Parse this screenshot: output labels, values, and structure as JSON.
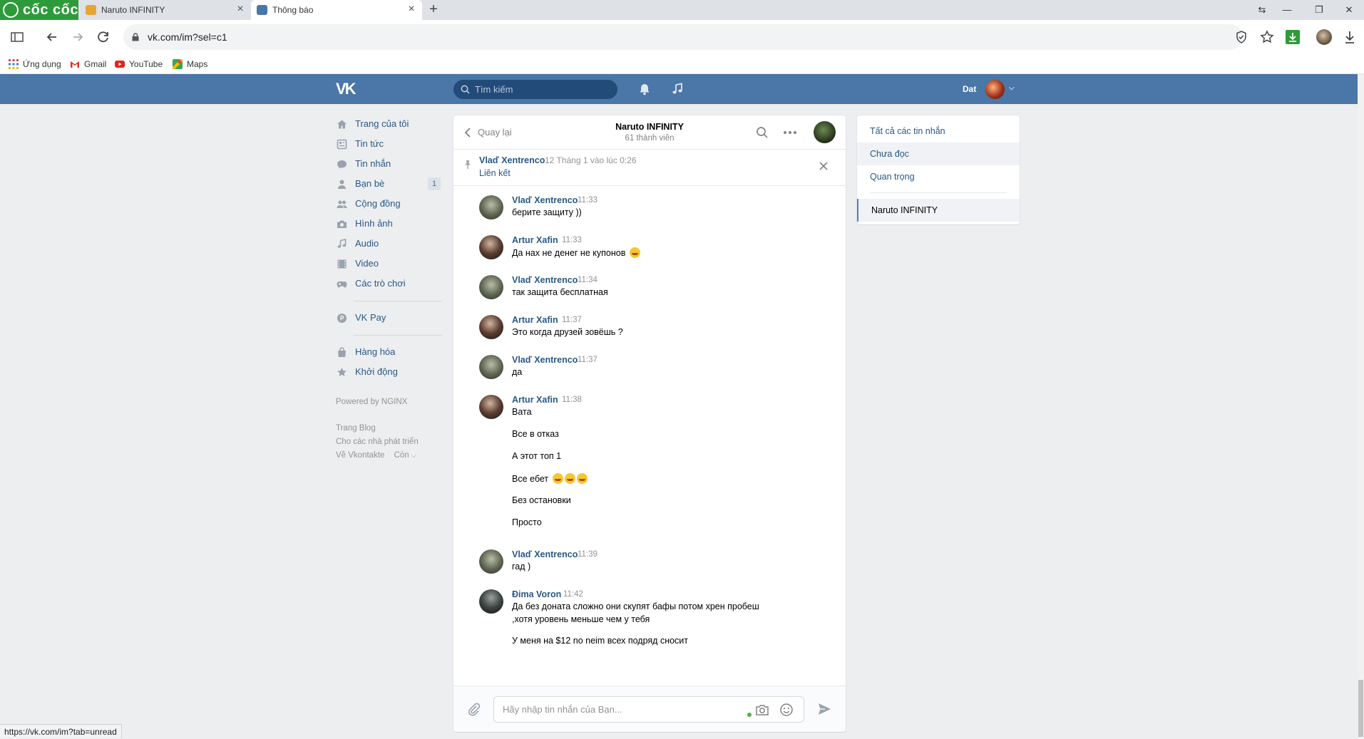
{
  "browser": {
    "brand": "cốc cốc",
    "tabs": [
      {
        "title": "Naruto INFINITY",
        "active": false
      },
      {
        "title": "Thông báo",
        "active": true
      }
    ],
    "url": "vk.com/im?sel=c1",
    "bookmarks": [
      "Ứng dụng",
      "Gmail",
      "YouTube",
      "Maps"
    ],
    "status_url": "https://vk.com/im?tab=unread"
  },
  "vk_header": {
    "logo": "VK",
    "search_placeholder": "Tìm kiếm",
    "user_name": "Dat"
  },
  "left_menu": {
    "items": [
      {
        "label": "Trang của tôi",
        "icon": "home-icon"
      },
      {
        "label": "Tin tức",
        "icon": "news-icon"
      },
      {
        "label": "Tin nhắn",
        "icon": "messages-icon"
      },
      {
        "label": "Bạn bè",
        "icon": "friends-icon",
        "badge": "1"
      },
      {
        "label": "Cộng đồng",
        "icon": "community-icon"
      },
      {
        "label": "Hình ảnh",
        "icon": "photo-icon"
      },
      {
        "label": "Audio",
        "icon": "music-note-icon"
      },
      {
        "label": "Video",
        "icon": "video-icon"
      },
      {
        "label": "Các trò chơi",
        "icon": "gamepad-icon"
      }
    ],
    "pay": {
      "label": "VK Pay",
      "icon": "vkpay-icon"
    },
    "extra": [
      {
        "label": "Hàng hóa",
        "icon": "bag-icon"
      },
      {
        "label": "Khởi động",
        "icon": "star-icon"
      }
    ],
    "footer": {
      "powered": "Powered by NGINX",
      "blog": "Trang Blog",
      "devs": "Cho các nhà phát triển",
      "about": "Về Vkontakte",
      "more": "Còn"
    }
  },
  "chat": {
    "back": "Quay lại",
    "title": "Naruto INFINITY",
    "members": "61 thành viên",
    "pinned": {
      "author": "Vlaď Xentrenco",
      "date": "12 Tháng 1 vào lúc 0:26",
      "text": "Liên kết"
    },
    "messages": [
      {
        "author": "Vlaď Xentrenco",
        "time": "11:33",
        "avatar": "vlad",
        "lines": [
          "берите защиту ))"
        ]
      },
      {
        "author": "Artur Xafin",
        "time": "11:33",
        "avatar": "artur",
        "lines": [
          "Да нах не денег не купонов"
        ],
        "emoji": [
          1
        ]
      },
      {
        "author": "Vlaď Xentrenco",
        "time": "11:34",
        "avatar": "vlad",
        "lines": [
          "так защита бесплатная"
        ]
      },
      {
        "author": "Artur Xafin",
        "time": "11:37",
        "avatar": "artur",
        "lines": [
          "Это когда друзей зовёшь ?"
        ]
      },
      {
        "author": "Vlaď Xentrenco",
        "time": "11:37",
        "avatar": "vlad",
        "lines": [
          "да"
        ]
      },
      {
        "author": "Artur Xafin",
        "time": "11:38",
        "avatar": "artur",
        "lines": [
          "Вата",
          "Все в отказ",
          "А этот топ 1",
          "Все ебет",
          "Без остановки",
          "Просто"
        ],
        "emoji": [
          0,
          0,
          0,
          3
        ]
      },
      {
        "author": "Vlaď Xentrenco",
        "time": "11:39",
        "avatar": "vlad",
        "lines": [
          "гад )"
        ]
      },
      {
        "author": "Đima Voron",
        "time": "11:42",
        "avatar": "dima",
        "lines": [
          "Да без доната сложно они скупят бафы потом хрен пробеш",
          ",хотя уровень меньше чем у тебя",
          "У меня на $12 no neim всех подряд сносит"
        ]
      }
    ],
    "input_placeholder": "Hãy nhập tin nhắn của Bạn..."
  },
  "right_menu": {
    "items": [
      "Tất cả các tin nhắn",
      "Chưa đọc",
      "Quan trọng"
    ],
    "active_chat": "Naruto INFINITY"
  }
}
